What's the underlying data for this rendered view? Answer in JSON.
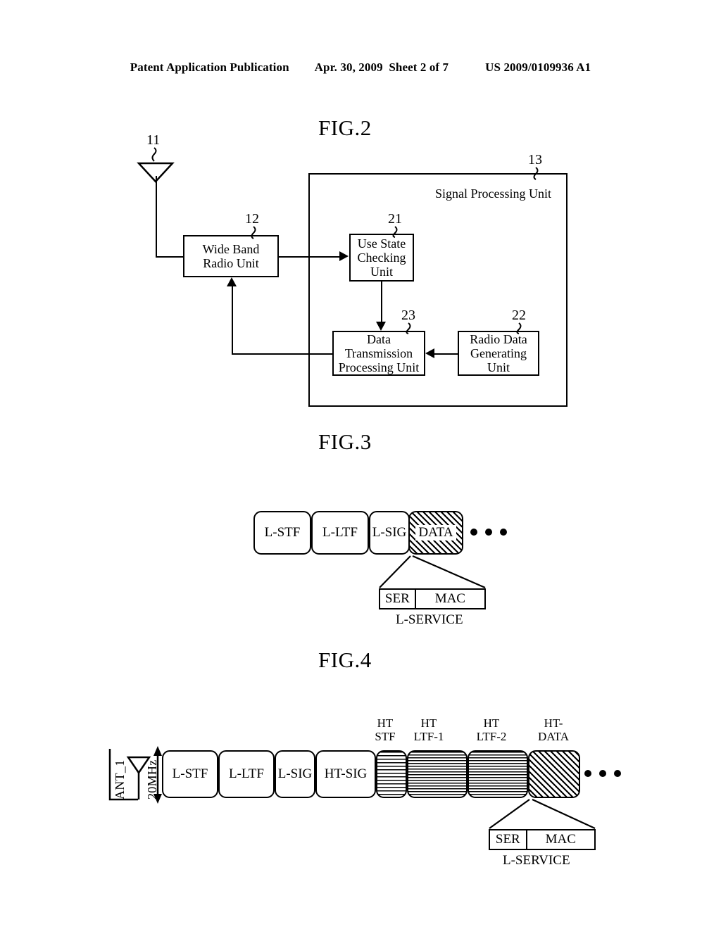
{
  "header": {
    "publication": "Patent Application Publication",
    "date_sheet": "Apr. 30, 2009  Sheet 2 of 7",
    "doc_number": "US 2009/0109936 A1"
  },
  "fig2": {
    "title": "FIG.2",
    "antenna_ref": "11",
    "radio_ref": "12",
    "spu_ref": "13",
    "use_state_ref": "21",
    "radio_data_ref": "22",
    "data_tx_ref": "23",
    "spu_label": "Signal Processing Unit",
    "blocks": [
      {
        "id": "wide-band-radio-unit",
        "lines": [
          "Wide Band",
          "Radio Unit"
        ]
      },
      {
        "id": "use-state-checking-unit",
        "lines": [
          "Use State",
          "Checking",
          "Unit"
        ]
      },
      {
        "id": "data-transmission-processing-unit",
        "lines": [
          "Data",
          "Transmission",
          "Processing Unit"
        ]
      },
      {
        "id": "radio-data-generating-unit",
        "lines": [
          "Radio Data",
          "Generating",
          "Unit"
        ]
      }
    ]
  },
  "fig3": {
    "title": "FIG.3",
    "fields": [
      {
        "label": "L-STF",
        "hatch": "none"
      },
      {
        "label": "L-LTF",
        "hatch": "none"
      },
      {
        "label": "L-SIG",
        "hatch": "none"
      },
      {
        "label": "DATA",
        "hatch": "diagonal"
      }
    ],
    "ellipsis": "• • •",
    "service_cells": [
      "SER",
      "MAC"
    ],
    "service_caption": "L-SERVICE"
  },
  "fig4": {
    "title": "FIG.4",
    "antenna_label": "ANT_1",
    "bandwidth_label": "20MHz",
    "fields": [
      {
        "label": "L-STF",
        "top_label": "",
        "hatch": "none"
      },
      {
        "label": "L-LTF",
        "top_label": "",
        "hatch": "none"
      },
      {
        "label": "L-SIG",
        "top_label": "",
        "hatch": "none"
      },
      {
        "label": "HT-SIG",
        "top_label": "",
        "hatch": "none"
      },
      {
        "label": "",
        "top_label": "HT\nSTF",
        "hatch": "horizontal"
      },
      {
        "label": "",
        "top_label": "HT\nLTF-1",
        "hatch": "horizontal-dense"
      },
      {
        "label": "",
        "top_label": "HT\nLTF-2",
        "hatch": "horizontal-dense"
      },
      {
        "label": "",
        "top_label": "HT-\nDATA",
        "hatch": "diagonal"
      }
    ],
    "top_labels": [
      {
        "l1": "HT",
        "l2": "STF"
      },
      {
        "l1": "HT",
        "l2": "LTF-1"
      },
      {
        "l1": "HT",
        "l2": "LTF-2"
      },
      {
        "l1": "HT-",
        "l2": "DATA"
      }
    ],
    "ellipsis": "• • •",
    "service_cells": [
      "SER",
      "MAC"
    ],
    "service_caption": "L-SERVICE"
  },
  "colors": {
    "ink": "#000000",
    "paper": "#ffffff"
  }
}
